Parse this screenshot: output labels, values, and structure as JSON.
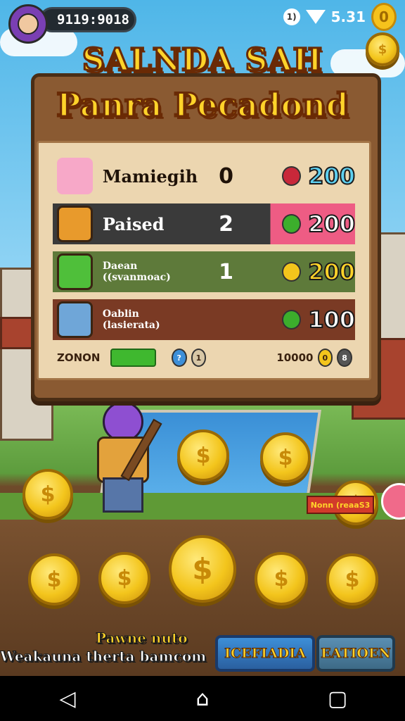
{
  "status_bar": {
    "score": "9119:9018",
    "time": "5.31",
    "circle_label": "1)",
    "coin_label": "0"
  },
  "title": {
    "line1": "SALNDA SAH",
    "line2": "Panra Pecadond"
  },
  "leaderboard": {
    "rows": [
      {
        "name": "Mamiegih",
        "num": "0",
        "value": "200",
        "gem_color": "#c8283a",
        "value_color": "#5ed0f0"
      },
      {
        "name": "Paised",
        "num": "2",
        "value": "200",
        "gem_color": "#3cae2c",
        "value_color": "#ffffff"
      },
      {
        "name": "Daean\n((svanmoac)",
        "num": "1",
        "value": "200",
        "gem_color": "#f3c51c",
        "value_color": "#ffd32a"
      },
      {
        "name": "Oablin\n(lasierata)",
        "num": "",
        "value": "100",
        "gem_color": "#3cae2c",
        "value_color": "#ffffff"
      }
    ],
    "footer": {
      "left_label": "ZONON",
      "mini1": "?",
      "mini2": "1",
      "right_value": "10000",
      "mini3": "0",
      "mini4": "8"
    }
  },
  "scene": {
    "sign_text": "Nonn (reaaS3"
  },
  "bottom": {
    "line1": "Pawne nuto",
    "line2": "Weakauna therta bamcom",
    "button1": "ICEFIADIA",
    "button2": "EATIOEN"
  },
  "navbar": {
    "back": "◁",
    "home": "⌂",
    "recent": "▢"
  }
}
